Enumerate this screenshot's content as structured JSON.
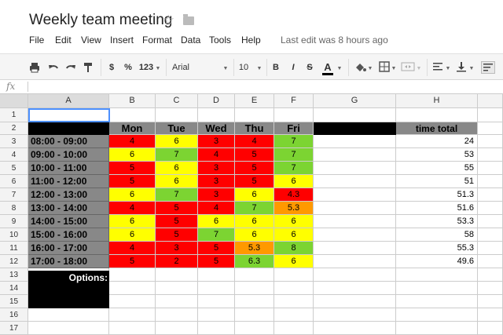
{
  "doc": {
    "title": "Weekly team meeting",
    "star_icon": "star-icon",
    "folder_icon": "folder-icon"
  },
  "menu": {
    "items": [
      "File",
      "Edit",
      "View",
      "Insert",
      "Format",
      "Data",
      "Tools",
      "Help"
    ],
    "last_edit": "Last edit was 8 hours ago"
  },
  "toolbar": {
    "currency": "$",
    "percent": "%",
    "number_format": "123",
    "font": "Arial",
    "font_size": "10",
    "bold": "B",
    "italic": "I",
    "strike": "S",
    "text_color": "A"
  },
  "formula": {
    "fx": "fx",
    "value": ""
  },
  "columns": [
    "A",
    "B",
    "C",
    "D",
    "E",
    "F",
    "G",
    "H"
  ],
  "rows": [
    "1",
    "2",
    "3",
    "4",
    "5",
    "6",
    "7",
    "8",
    "9",
    "10",
    "11",
    "12",
    "13",
    "14",
    "15",
    "16",
    "17"
  ],
  "header": {
    "days": [
      "Mon",
      "Tue",
      "Wed",
      "Thu",
      "Fri"
    ],
    "total": "time total"
  },
  "slots": [
    {
      "time": "08:00 - 09:00",
      "vals": [
        "4",
        "6",
        "3",
        "4",
        "7"
      ],
      "colors": [
        "red",
        "yel",
        "red",
        "red",
        "grn"
      ],
      "total": "24"
    },
    {
      "time": "09:00 - 10:00",
      "vals": [
        "6",
        "7",
        "4",
        "5",
        "7"
      ],
      "colors": [
        "yel",
        "grn",
        "red",
        "red",
        "grn"
      ],
      "total": "53"
    },
    {
      "time": "10:00 - 11:00",
      "vals": [
        "5",
        "6",
        "3",
        "5",
        "7"
      ],
      "colors": [
        "red",
        "yel",
        "red",
        "red",
        "grn"
      ],
      "total": "55"
    },
    {
      "time": "11:00 - 12:00",
      "vals": [
        "5",
        "6",
        "3",
        "5",
        "6"
      ],
      "colors": [
        "red",
        "yel",
        "red",
        "red",
        "yel"
      ],
      "total": "51"
    },
    {
      "time": "12:00 - 13:00",
      "vals": [
        "6",
        "7",
        "3",
        "6",
        "4.3"
      ],
      "colors": [
        "yel",
        "grn",
        "red",
        "yel",
        "red"
      ],
      "total": "51.3"
    },
    {
      "time": "13:00 - 14:00",
      "vals": [
        "4",
        "5",
        "4",
        "7",
        "5.3"
      ],
      "colors": [
        "red",
        "red",
        "red",
        "grn",
        "org"
      ],
      "total": "51.6"
    },
    {
      "time": "14:00 - 15:00",
      "vals": [
        "6",
        "5",
        "6",
        "6",
        "6"
      ],
      "colors": [
        "yel",
        "red",
        "yel",
        "yel",
        "yel"
      ],
      "total": "53.3"
    },
    {
      "time": "15:00 - 16:00",
      "vals": [
        "6",
        "5",
        "7",
        "6",
        "6"
      ],
      "colors": [
        "yel",
        "red",
        "grn",
        "yel",
        "yel"
      ],
      "total": "58"
    },
    {
      "time": "16:00 - 17:00",
      "vals": [
        "4",
        "3",
        "5",
        "5.3",
        "8"
      ],
      "colors": [
        "red",
        "red",
        "red",
        "org",
        "grn"
      ],
      "total": "55.3"
    },
    {
      "time": "17:00 - 18:00",
      "vals": [
        "5",
        "2",
        "5",
        "6.3",
        "6"
      ],
      "colors": [
        "red",
        "red",
        "red",
        "grn",
        "yel"
      ],
      "total": "49.6"
    }
  ],
  "options_label": "Options:"
}
